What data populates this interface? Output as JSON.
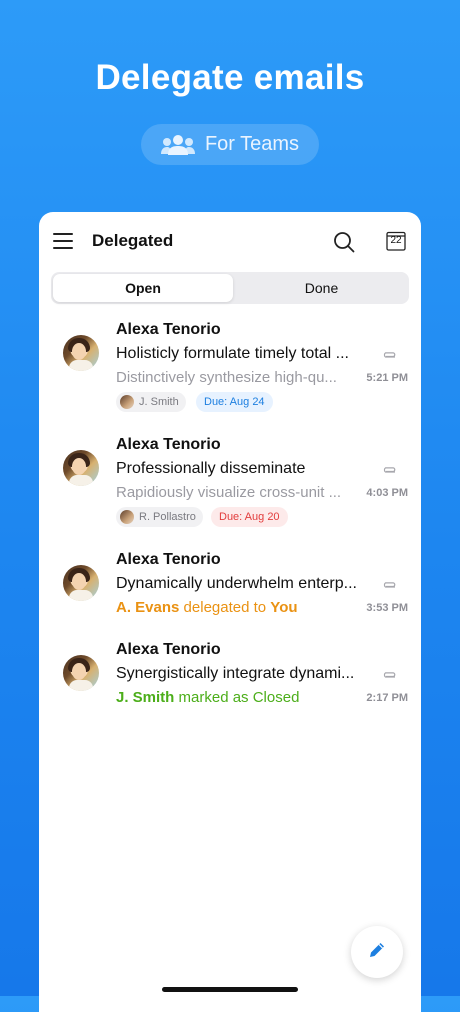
{
  "hero": {
    "title": "Delegate emails",
    "badge_label": "For Teams"
  },
  "app": {
    "title": "Delegated",
    "calendar_day": "22"
  },
  "tabs": [
    {
      "label": "Open",
      "selected": true
    },
    {
      "label": "Done",
      "selected": false
    }
  ],
  "emails": [
    {
      "sender": "Alexa Tenorio",
      "subject": "Holisticly formulate timely total ...",
      "preview": "Distinctively synthesize high-qu...",
      "time": "5:21 PM",
      "assignee": "J. Smith",
      "due": "Due: Aug 24"
    },
    {
      "sender": "Alexa Tenorio",
      "subject": "Professionally disseminate",
      "preview": "Rapidiously visualize cross-unit ...",
      "time": "4:03 PM",
      "assignee": "R. Pollastro",
      "due": "Due: Aug 20"
    },
    {
      "sender": "Alexa Tenorio",
      "subject": "Dynamically underwhelm enterp...",
      "time": "3:53 PM",
      "status_actor": "A. Evans",
      "status_text": "delegated to",
      "status_target": "You"
    },
    {
      "sender": "Alexa Tenorio",
      "subject": "Synergistically integrate dynami...",
      "time": "2:17 PM",
      "status_actor": "J. Smith",
      "status_text": "marked as Closed"
    }
  ],
  "colors": {
    "background": "#1d86f0",
    "due_blue": "#1d7fe0",
    "due_red": "#e23d3d",
    "delegated_orange": "#ea9213",
    "closed_green": "#4cae1a"
  },
  "icons": [
    "menu-icon",
    "search-icon",
    "calendar-icon",
    "attachment-icon",
    "team-icon",
    "compose-icon"
  ]
}
